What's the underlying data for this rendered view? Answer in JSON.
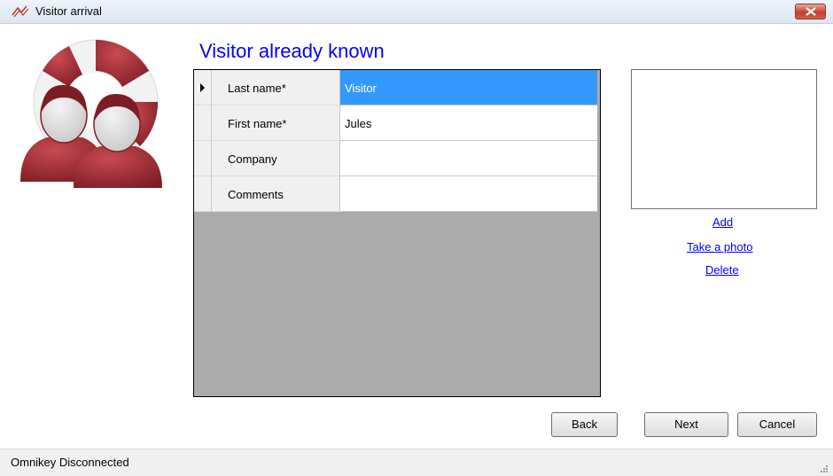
{
  "window": {
    "title": "Visitor arrival"
  },
  "heading": "Visitor already known",
  "form": {
    "rows": [
      {
        "label": "Last name*",
        "value": "Visitor",
        "selected": true
      },
      {
        "label": "First name*",
        "value": "Jules",
        "selected": false
      },
      {
        "label": "Company",
        "value": "",
        "selected": false
      },
      {
        "label": "Comments",
        "value": "",
        "selected": false
      }
    ]
  },
  "photo": {
    "add": "Add",
    "take_photo": "Take a photo",
    "delete": "Delete"
  },
  "buttons": {
    "back": "Back",
    "next": "Next",
    "cancel": "Cancel"
  },
  "status": {
    "text": "Omnikey Disconnected"
  },
  "colors": {
    "heading": "#0000ff",
    "selection": "#3399ff",
    "grid_background": "#ababab",
    "logo_red": "#b02a35"
  }
}
